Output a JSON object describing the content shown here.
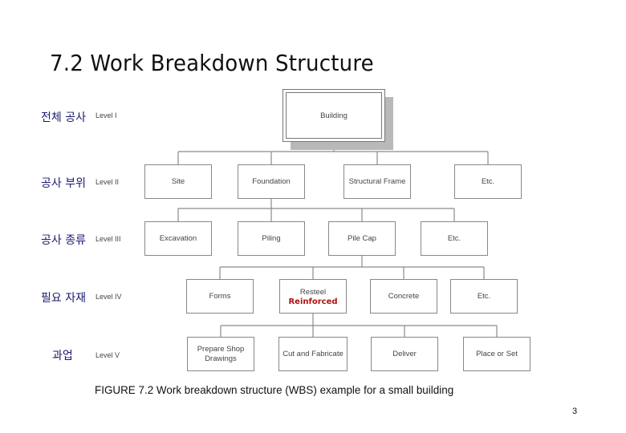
{
  "slide": {
    "title": "7.2 Work Breakdown Structure",
    "caption": "FIGURE 7.2 Work breakdown structure (WBS) example for a small building",
    "page_number": "3"
  },
  "levels": [
    {
      "korean": "전체 공사",
      "label": "Level I"
    },
    {
      "korean": "공사 부위",
      "label": "Level II"
    },
    {
      "korean": "공사 종류",
      "label": "Level III"
    },
    {
      "korean": "필요 자재",
      "label": "Level IV"
    },
    {
      "korean": "과업",
      "label": "Level V"
    }
  ],
  "wbs": {
    "level1": {
      "label": "Building"
    },
    "level2": [
      {
        "label": "Site"
      },
      {
        "label": "Foundation"
      },
      {
        "label": "Structural Frame"
      },
      {
        "label": "Etc."
      }
    ],
    "level3": [
      {
        "label": "Excavation"
      },
      {
        "label": "Piling"
      },
      {
        "label": "Pile Cap"
      },
      {
        "label": "Etc."
      }
    ],
    "level4": [
      {
        "label": "Forms"
      },
      {
        "label": "Resteel",
        "annotation": "Reinforced"
      },
      {
        "label": "Concrete"
      },
      {
        "label": "Etc."
      }
    ],
    "level5": [
      {
        "label": "Prepare Shop",
        "label2": "Drawings"
      },
      {
        "label": "Cut and Fabricate"
      },
      {
        "label": "Deliver"
      },
      {
        "label": "Place or Set"
      }
    ],
    "parents": {
      "level2": "Building",
      "level3": "Foundation",
      "level4": "Pile Cap",
      "level5": "Resteel"
    }
  },
  "colors": {
    "annotation": "#b01010",
    "korean_labels": "#1a1a6e",
    "box_border": "#888888",
    "shadow": "#b9b9b9"
  }
}
